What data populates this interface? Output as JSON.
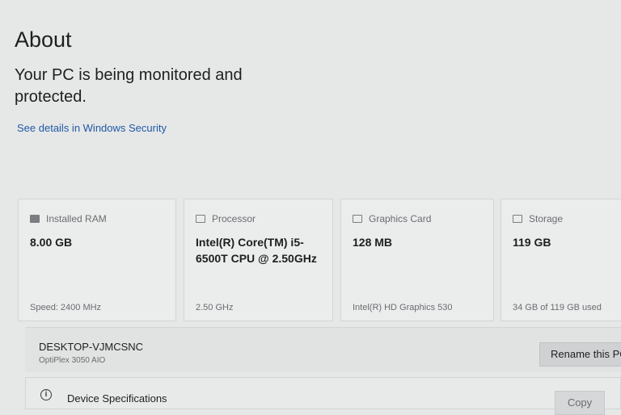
{
  "page": {
    "title": "About",
    "security_status": "Your PC is being monitored and protected.",
    "security_link": "See details in Windows Security"
  },
  "cards": [
    {
      "icon": "ram-icon",
      "label": "Installed RAM",
      "value": "8.00 GB",
      "sub": "Speed: 2400 MHz"
    },
    {
      "icon": "processor-icon",
      "label": "Processor",
      "value": "Intel(R) Core(TM) i5-6500T CPU @ 2.50GHz",
      "sub": "2.50 GHz"
    },
    {
      "icon": "graphics-card-icon",
      "label": "Graphics Card",
      "value": "128 MB",
      "sub": "Intel(R) HD Graphics 530"
    },
    {
      "icon": "storage-icon",
      "label": "Storage",
      "value": "119 GB",
      "sub": "34 GB of 119 GB used"
    }
  ],
  "device": {
    "name": "DESKTOP-VJMCSNC",
    "model": "OptiPlex 3050 AIO",
    "rename_label": "Rename this PC"
  },
  "specifications": {
    "icon": "info-icon",
    "label": "Device Specifications",
    "copy_label": "Copy"
  }
}
